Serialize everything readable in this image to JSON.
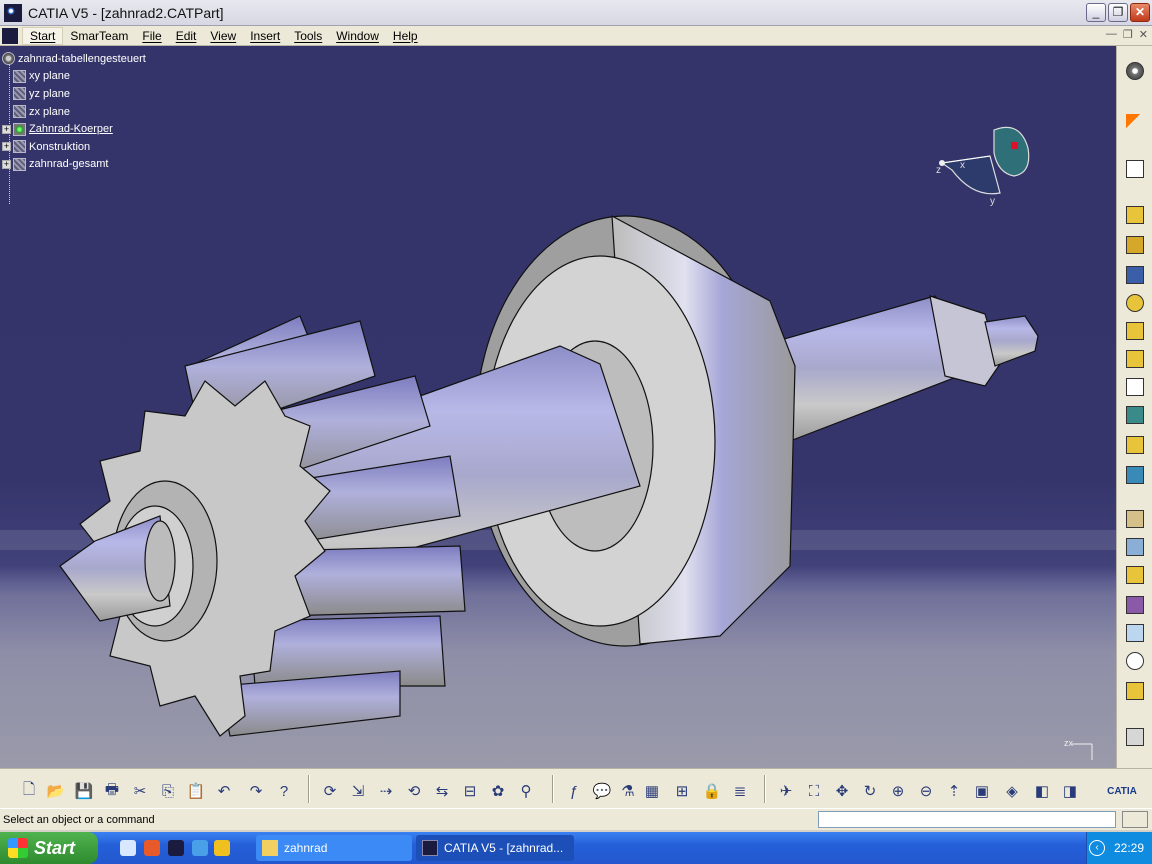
{
  "window": {
    "title": "CATIA V5 - [zahnrad2.CATPart]",
    "buttons": {
      "minimize": "_",
      "restore": "❐",
      "close": "✕"
    }
  },
  "menu": {
    "items": [
      "Start",
      "SmarTeam",
      "File",
      "Edit",
      "View",
      "Insert",
      "Tools",
      "Window",
      "Help"
    ]
  },
  "tree": {
    "root": "zahnrad-tabellengesteuert",
    "items": [
      {
        "label": "xy plane",
        "expandable": false
      },
      {
        "label": "yz plane",
        "expandable": false
      },
      {
        "label": "zx plane",
        "expandable": false
      },
      {
        "label": "Zahnrad-Koerper",
        "expandable": true
      },
      {
        "label": "Konstruktion",
        "expandable": true
      },
      {
        "label": "zahnrad-gesamt",
        "expandable": true
      }
    ]
  },
  "compass": {
    "z": "z",
    "x": "x",
    "y": "y"
  },
  "axis_label": "zx",
  "catia_logo": "CATIA",
  "status": {
    "message": "Select an object or a command"
  },
  "taskbar": {
    "start": "Start",
    "tasks": [
      "zahnrad",
      "CATIA V5 - [zahnrad..."
    ],
    "clock": "22:29"
  },
  "colors": {
    "background_top": "#34346a",
    "part_surface": "#c8c8c8",
    "part_highlight": "#a9a9e6"
  }
}
